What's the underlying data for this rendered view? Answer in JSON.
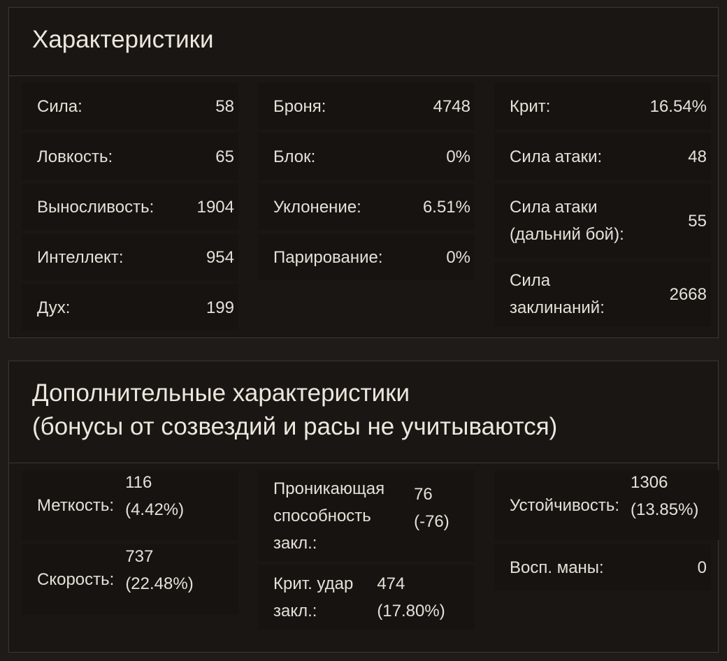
{
  "main": {
    "title": "Характеристики",
    "col1": [
      {
        "label": "Сила:",
        "value": "58"
      },
      {
        "label": "Ловкость:",
        "value": "65"
      },
      {
        "label": "Выносливость:",
        "value": "1904"
      },
      {
        "label": "Интеллект:",
        "value": "954"
      },
      {
        "label": "Дух:",
        "value": "199"
      }
    ],
    "col2": [
      {
        "label": "Броня:",
        "value": "4748"
      },
      {
        "label": "Блок:",
        "value": "0%"
      },
      {
        "label": "Уклонение:",
        "value": "6.51%"
      },
      {
        "label": "Парирование:",
        "value": "0%"
      }
    ],
    "col3": [
      {
        "label": "Крит:",
        "value": "16.54%"
      },
      {
        "label": "Сила атаки:",
        "value": "48"
      },
      {
        "label1": "Сила атаки",
        "label2": "(дальний бой):",
        "value": "55"
      },
      {
        "label1": "Сила",
        "label2": "заклинаний:",
        "value": "2668"
      }
    ]
  },
  "extra": {
    "title_line1": "Дополнительные характеристики",
    "title_line2": "(бонусы от созвездий и расы не учитываются)",
    "col1": [
      {
        "label": "Меткость:",
        "value1": "116",
        "value2": "(4.42%)"
      },
      {
        "label": "Скорость:",
        "value1": "737",
        "value2": "(22.48%)"
      }
    ],
    "col2": [
      {
        "label1": "Проникающая",
        "label2": "способность",
        "label3": "закл.:",
        "value1": "76",
        "value2": "(-76)"
      },
      {
        "label1": "Крит. удар",
        "label2": "закл.:",
        "value1": "474",
        "value2": "(17.80%)"
      }
    ],
    "col3": [
      {
        "label": "Устойчивость:",
        "value1": "1306",
        "value2": "(13.85%)"
      },
      {
        "label": "Восп. маны:",
        "value": "0"
      }
    ]
  }
}
